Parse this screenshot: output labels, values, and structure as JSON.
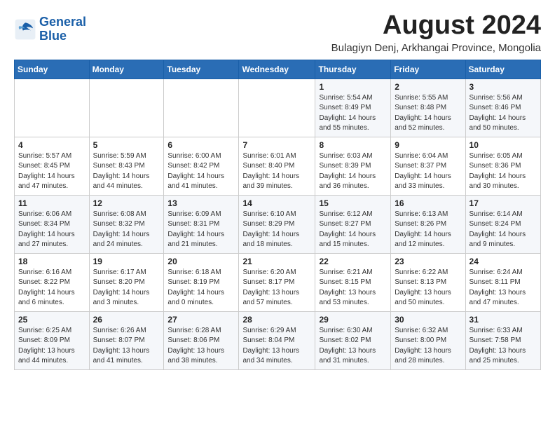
{
  "logo": {
    "line1": "General",
    "line2": "Blue"
  },
  "title": "August 2024",
  "subtitle": "Bulagiyn Denj, Arkhangai Province, Mongolia",
  "days_of_week": [
    "Sunday",
    "Monday",
    "Tuesday",
    "Wednesday",
    "Thursday",
    "Friday",
    "Saturday"
  ],
  "weeks": [
    [
      {
        "day": "",
        "info": ""
      },
      {
        "day": "",
        "info": ""
      },
      {
        "day": "",
        "info": ""
      },
      {
        "day": "",
        "info": ""
      },
      {
        "day": "1",
        "info": "Sunrise: 5:54 AM\nSunset: 8:49 PM\nDaylight: 14 hours\nand 55 minutes."
      },
      {
        "day": "2",
        "info": "Sunrise: 5:55 AM\nSunset: 8:48 PM\nDaylight: 14 hours\nand 52 minutes."
      },
      {
        "day": "3",
        "info": "Sunrise: 5:56 AM\nSunset: 8:46 PM\nDaylight: 14 hours\nand 50 minutes."
      }
    ],
    [
      {
        "day": "4",
        "info": "Sunrise: 5:57 AM\nSunset: 8:45 PM\nDaylight: 14 hours\nand 47 minutes."
      },
      {
        "day": "5",
        "info": "Sunrise: 5:59 AM\nSunset: 8:43 PM\nDaylight: 14 hours\nand 44 minutes."
      },
      {
        "day": "6",
        "info": "Sunrise: 6:00 AM\nSunset: 8:42 PM\nDaylight: 14 hours\nand 41 minutes."
      },
      {
        "day": "7",
        "info": "Sunrise: 6:01 AM\nSunset: 8:40 PM\nDaylight: 14 hours\nand 39 minutes."
      },
      {
        "day": "8",
        "info": "Sunrise: 6:03 AM\nSunset: 8:39 PM\nDaylight: 14 hours\nand 36 minutes."
      },
      {
        "day": "9",
        "info": "Sunrise: 6:04 AM\nSunset: 8:37 PM\nDaylight: 14 hours\nand 33 minutes."
      },
      {
        "day": "10",
        "info": "Sunrise: 6:05 AM\nSunset: 8:36 PM\nDaylight: 14 hours\nand 30 minutes."
      }
    ],
    [
      {
        "day": "11",
        "info": "Sunrise: 6:06 AM\nSunset: 8:34 PM\nDaylight: 14 hours\nand 27 minutes."
      },
      {
        "day": "12",
        "info": "Sunrise: 6:08 AM\nSunset: 8:32 PM\nDaylight: 14 hours\nand 24 minutes."
      },
      {
        "day": "13",
        "info": "Sunrise: 6:09 AM\nSunset: 8:31 PM\nDaylight: 14 hours\nand 21 minutes."
      },
      {
        "day": "14",
        "info": "Sunrise: 6:10 AM\nSunset: 8:29 PM\nDaylight: 14 hours\nand 18 minutes."
      },
      {
        "day": "15",
        "info": "Sunrise: 6:12 AM\nSunset: 8:27 PM\nDaylight: 14 hours\nand 15 minutes."
      },
      {
        "day": "16",
        "info": "Sunrise: 6:13 AM\nSunset: 8:26 PM\nDaylight: 14 hours\nand 12 minutes."
      },
      {
        "day": "17",
        "info": "Sunrise: 6:14 AM\nSunset: 8:24 PM\nDaylight: 14 hours\nand 9 minutes."
      }
    ],
    [
      {
        "day": "18",
        "info": "Sunrise: 6:16 AM\nSunset: 8:22 PM\nDaylight: 14 hours\nand 6 minutes."
      },
      {
        "day": "19",
        "info": "Sunrise: 6:17 AM\nSunset: 8:20 PM\nDaylight: 14 hours\nand 3 minutes."
      },
      {
        "day": "20",
        "info": "Sunrise: 6:18 AM\nSunset: 8:19 PM\nDaylight: 14 hours\nand 0 minutes."
      },
      {
        "day": "21",
        "info": "Sunrise: 6:20 AM\nSunset: 8:17 PM\nDaylight: 13 hours\nand 57 minutes."
      },
      {
        "day": "22",
        "info": "Sunrise: 6:21 AM\nSunset: 8:15 PM\nDaylight: 13 hours\nand 53 minutes."
      },
      {
        "day": "23",
        "info": "Sunrise: 6:22 AM\nSunset: 8:13 PM\nDaylight: 13 hours\nand 50 minutes."
      },
      {
        "day": "24",
        "info": "Sunrise: 6:24 AM\nSunset: 8:11 PM\nDaylight: 13 hours\nand 47 minutes."
      }
    ],
    [
      {
        "day": "25",
        "info": "Sunrise: 6:25 AM\nSunset: 8:09 PM\nDaylight: 13 hours\nand 44 minutes."
      },
      {
        "day": "26",
        "info": "Sunrise: 6:26 AM\nSunset: 8:07 PM\nDaylight: 13 hours\nand 41 minutes."
      },
      {
        "day": "27",
        "info": "Sunrise: 6:28 AM\nSunset: 8:06 PM\nDaylight: 13 hours\nand 38 minutes."
      },
      {
        "day": "28",
        "info": "Sunrise: 6:29 AM\nSunset: 8:04 PM\nDaylight: 13 hours\nand 34 minutes."
      },
      {
        "day": "29",
        "info": "Sunrise: 6:30 AM\nSunset: 8:02 PM\nDaylight: 13 hours\nand 31 minutes."
      },
      {
        "day": "30",
        "info": "Sunrise: 6:32 AM\nSunset: 8:00 PM\nDaylight: 13 hours\nand 28 minutes."
      },
      {
        "day": "31",
        "info": "Sunrise: 6:33 AM\nSunset: 7:58 PM\nDaylight: 13 hours\nand 25 minutes."
      }
    ]
  ]
}
